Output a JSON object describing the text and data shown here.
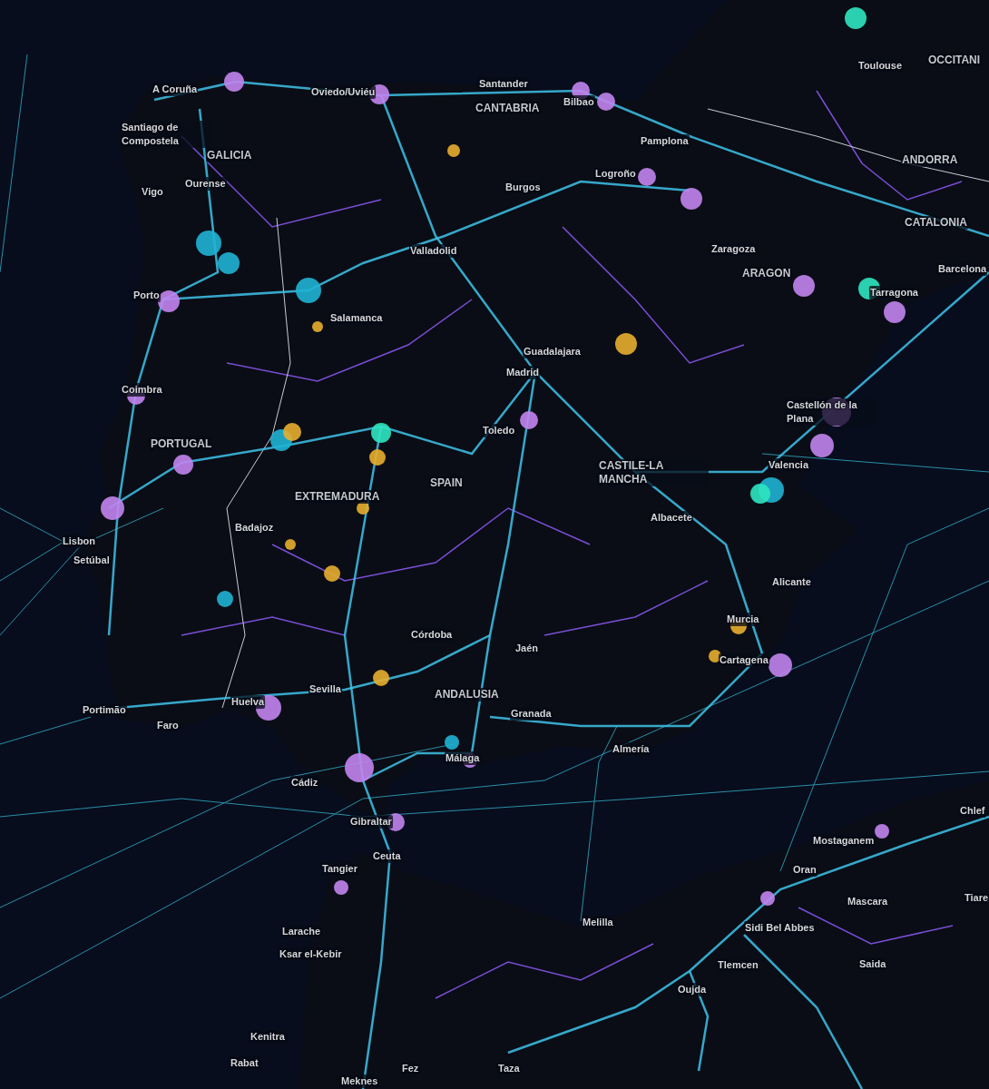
{
  "map": {
    "labels": [
      {
        "text": "Toulouse",
        "kind": "city"
      },
      {
        "text": "OCCITANI",
        "kind": "region"
      },
      {
        "text": "A Coruña",
        "kind": "city"
      },
      {
        "text": "Oviedo/Uviéu",
        "kind": "city"
      },
      {
        "text": "Santander",
        "kind": "city"
      },
      {
        "text": "Bilbao",
        "kind": "city"
      },
      {
        "text": "CANTABRIA",
        "kind": "region"
      },
      {
        "text": "Santiago de Compostela",
        "kind": "city"
      },
      {
        "text": "GALICIA",
        "kind": "region"
      },
      {
        "text": "Pamplona",
        "kind": "city"
      },
      {
        "text": "Vigo",
        "kind": "city"
      },
      {
        "text": "Ourense",
        "kind": "city"
      },
      {
        "text": "Logroño",
        "kind": "city"
      },
      {
        "text": "Burgos",
        "kind": "city"
      },
      {
        "text": "ANDORRA",
        "kind": "region"
      },
      {
        "text": "CATALONIA",
        "kind": "region"
      },
      {
        "text": "Valladolid",
        "kind": "city"
      },
      {
        "text": "Zaragoza",
        "kind": "city"
      },
      {
        "text": "ARAGON",
        "kind": "region"
      },
      {
        "text": "Barcelona",
        "kind": "city"
      },
      {
        "text": "Porto",
        "kind": "city"
      },
      {
        "text": "Tarragona",
        "kind": "city"
      },
      {
        "text": "Salamanca",
        "kind": "city"
      },
      {
        "text": "Guadalajara",
        "kind": "city"
      },
      {
        "text": "Madrid",
        "kind": "city"
      },
      {
        "text": "Coimbra",
        "kind": "city"
      },
      {
        "text": "Castellón de la Plana",
        "kind": "city"
      },
      {
        "text": "Toledo",
        "kind": "city"
      },
      {
        "text": "PORTUGAL",
        "kind": "region"
      },
      {
        "text": "Valencia",
        "kind": "city"
      },
      {
        "text": "CASTILE-LA MANCHA",
        "kind": "region"
      },
      {
        "text": "SPAIN",
        "kind": "region"
      },
      {
        "text": "EXTREMADURA",
        "kind": "region"
      },
      {
        "text": "Badajoz",
        "kind": "city"
      },
      {
        "text": "Albacete",
        "kind": "city"
      },
      {
        "text": "Lisbon",
        "kind": "city"
      },
      {
        "text": "Setúbal",
        "kind": "city"
      },
      {
        "text": "Alicante",
        "kind": "city"
      },
      {
        "text": "Murcia",
        "kind": "city"
      },
      {
        "text": "Córdoba",
        "kind": "city"
      },
      {
        "text": "Jaén",
        "kind": "city"
      },
      {
        "text": "Cartagena",
        "kind": "city"
      },
      {
        "text": "ANDALUSIA",
        "kind": "region"
      },
      {
        "text": "Sevilla",
        "kind": "city"
      },
      {
        "text": "Granada",
        "kind": "city"
      },
      {
        "text": "Huelva",
        "kind": "city"
      },
      {
        "text": "Portimão",
        "kind": "city"
      },
      {
        "text": "Faro",
        "kind": "city"
      },
      {
        "text": "Almería",
        "kind": "city"
      },
      {
        "text": "Málaga",
        "kind": "city"
      },
      {
        "text": "Cádiz",
        "kind": "city"
      },
      {
        "text": "Gibraltar",
        "kind": "city"
      },
      {
        "text": "Chlef",
        "kind": "city"
      },
      {
        "text": "Ceuta",
        "kind": "city"
      },
      {
        "text": "Mostaganem",
        "kind": "city"
      },
      {
        "text": "Tangier",
        "kind": "city"
      },
      {
        "text": "Oran",
        "kind": "city"
      },
      {
        "text": "Mascara",
        "kind": "city"
      },
      {
        "text": "Tiare",
        "kind": "city"
      },
      {
        "text": "Melilla",
        "kind": "city"
      },
      {
        "text": "Sidi Bel Abbes",
        "kind": "city"
      },
      {
        "text": "Larache",
        "kind": "city"
      },
      {
        "text": "Ksar el-Kebir",
        "kind": "city"
      },
      {
        "text": "Tlemcen",
        "kind": "city"
      },
      {
        "text": "Saida",
        "kind": "city"
      },
      {
        "text": "Oujda",
        "kind": "city"
      },
      {
        "text": "Kenitra",
        "kind": "city"
      },
      {
        "text": "Rabat",
        "kind": "city"
      },
      {
        "text": "Taza",
        "kind": "city"
      },
      {
        "text": "Fez",
        "kind": "city"
      },
      {
        "text": "Meknes",
        "kind": "city"
      }
    ]
  }
}
